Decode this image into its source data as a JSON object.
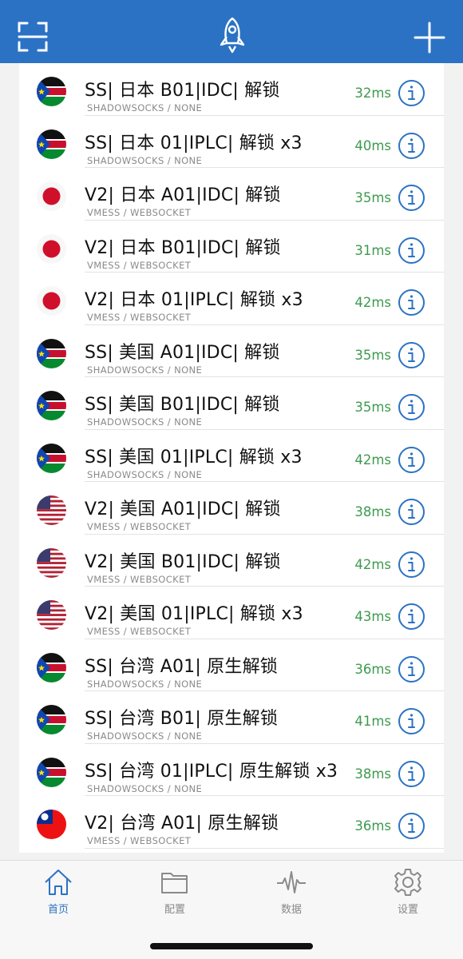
{
  "header": {
    "icons": [
      "scan-icon",
      "rocket-icon",
      "add-icon"
    ],
    "background": "#2b72c4"
  },
  "servers": [
    {
      "name": "SS| 日本 B01|IDC| 解锁",
      "protocol": "SHADOWSOCKS / NONE",
      "latency": "32ms",
      "flag": "south-sudan"
    },
    {
      "name": "SS| 日本 01|IPLC| 解锁 x3",
      "protocol": "SHADOWSOCKS / NONE",
      "latency": "40ms",
      "flag": "south-sudan"
    },
    {
      "name": "V2| 日本 A01|IDC| 解锁",
      "protocol": "VMESS / WEBSOCKET",
      "latency": "35ms",
      "flag": "japan"
    },
    {
      "name": "V2| 日本 B01|IDC| 解锁",
      "protocol": "VMESS / WEBSOCKET",
      "latency": "31ms",
      "flag": "japan"
    },
    {
      "name": "V2| 日本 01|IPLC| 解锁 x3",
      "protocol": "VMESS / WEBSOCKET",
      "latency": "42ms",
      "flag": "japan"
    },
    {
      "name": "SS| 美国 A01|IDC| 解锁",
      "protocol": "SHADOWSOCKS / NONE",
      "latency": "35ms",
      "flag": "south-sudan"
    },
    {
      "name": "SS| 美国 B01|IDC| 解锁",
      "protocol": "SHADOWSOCKS / NONE",
      "latency": "35ms",
      "flag": "south-sudan"
    },
    {
      "name": "SS| 美国 01|IPLC| 解锁 x3",
      "protocol": "SHADOWSOCKS / NONE",
      "latency": "42ms",
      "flag": "south-sudan"
    },
    {
      "name": "V2| 美国 A01|IDC| 解锁",
      "protocol": "VMESS / WEBSOCKET",
      "latency": "38ms",
      "flag": "usa"
    },
    {
      "name": "V2| 美国 B01|IDC| 解锁",
      "protocol": "VMESS / WEBSOCKET",
      "latency": "42ms",
      "flag": "usa"
    },
    {
      "name": "V2| 美国 01|IPLC| 解锁 x3",
      "protocol": "VMESS / WEBSOCKET",
      "latency": "43ms",
      "flag": "usa"
    },
    {
      "name": "SS| 台湾 A01| 原生解锁",
      "protocol": "SHADOWSOCKS / NONE",
      "latency": "36ms",
      "flag": "south-sudan"
    },
    {
      "name": "SS| 台湾 B01| 原生解锁",
      "protocol": "SHADOWSOCKS / NONE",
      "latency": "41ms",
      "flag": "south-sudan"
    },
    {
      "name": "SS| 台湾 01|IPLC| 原生解锁 x3",
      "protocol": "SHADOWSOCKS / NONE",
      "latency": "38ms",
      "flag": "south-sudan"
    },
    {
      "name": "V2| 台湾 A01| 原生解锁",
      "protocol": "VMESS / WEBSOCKET",
      "latency": "36ms",
      "flag": "taiwan"
    }
  ],
  "tabs": [
    {
      "label": "首页",
      "icon": "home-icon",
      "active": true
    },
    {
      "label": "配置",
      "icon": "folder-icon",
      "active": false
    },
    {
      "label": "数据",
      "icon": "activity-icon",
      "active": false
    },
    {
      "label": "设置",
      "icon": "gear-icon",
      "active": false
    }
  ],
  "colors": {
    "accent": "#2b72c4",
    "latency": "#3d9a4f",
    "tab_inactive": "#888888"
  }
}
